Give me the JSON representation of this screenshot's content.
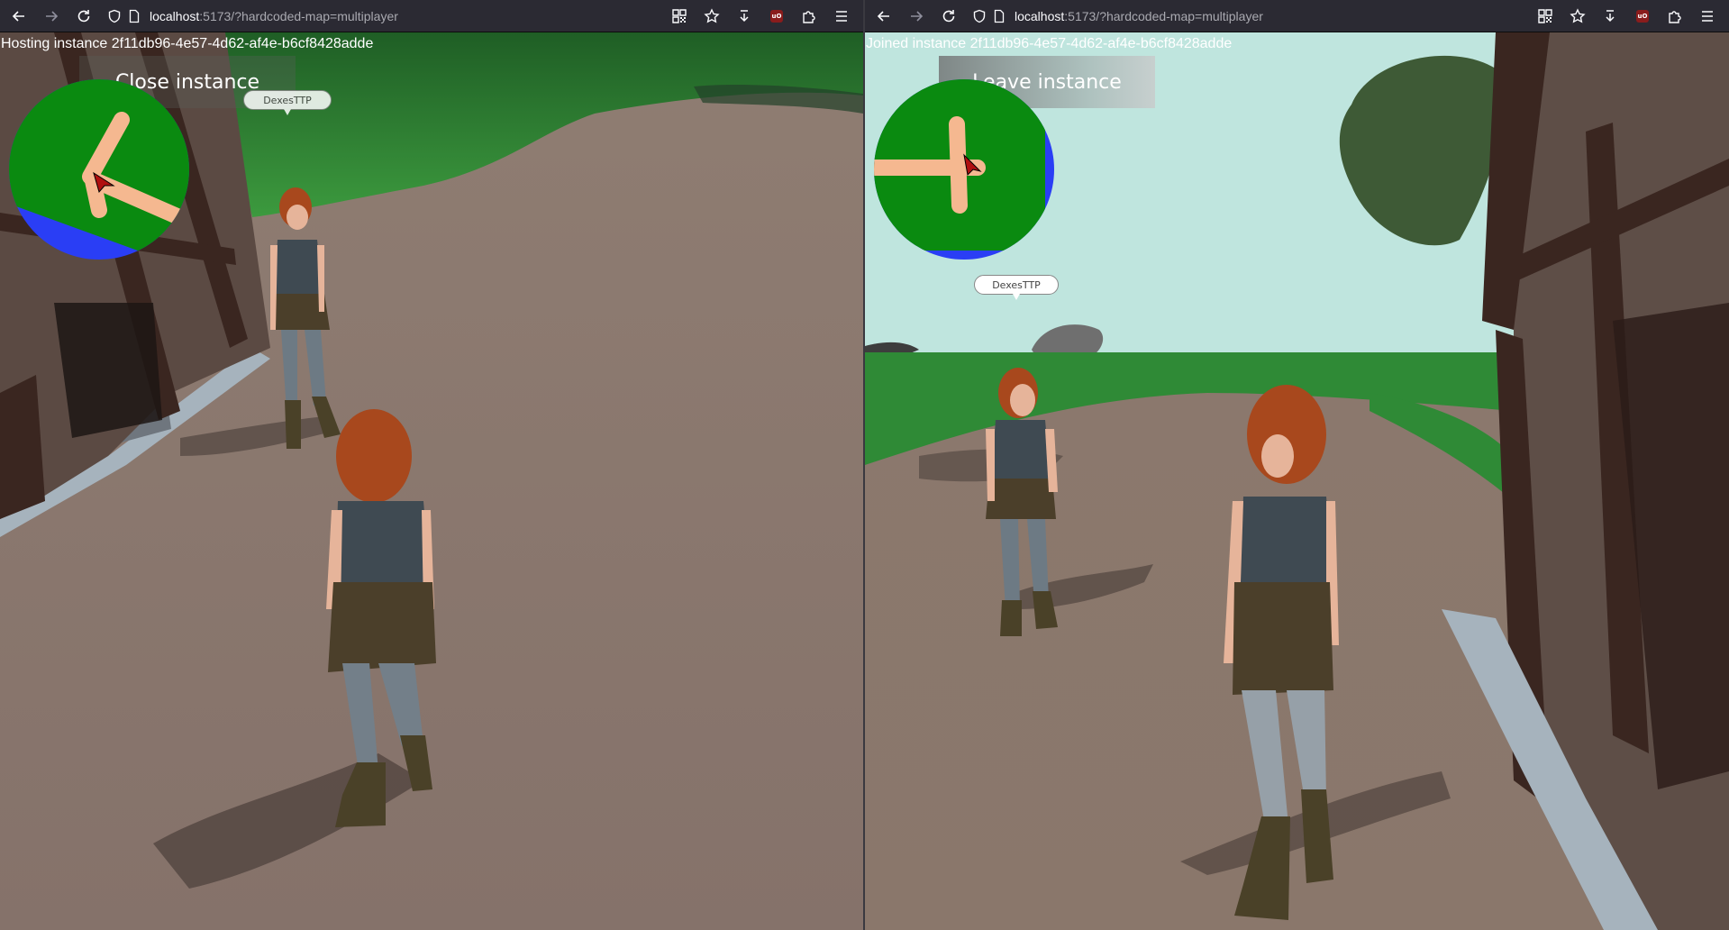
{
  "left_window": {
    "url_host": "localhost",
    "url_rest": ":5173/?hardcoded-map=multiplayer",
    "instance_status": "Hosting instance 2f11db96-4e57-4d62-af4e-b6cf8428adde",
    "instance_button": "Close instance",
    "nametag": "DexesTTP"
  },
  "right_window": {
    "url_host": "localhost",
    "url_rest": ":5173/?hardcoded-map=multiplayer",
    "instance_status": "Joined instance 2f11db96-4e57-4d62-af4e-b6cf8428adde",
    "instance_button": "Leave instance",
    "nametag": "DexesTTP"
  },
  "icons": {
    "back": "back-arrow-icon",
    "forward": "forward-arrow-icon",
    "reload": "reload-icon",
    "tracking_protection": "shield-icon",
    "page": "page-icon",
    "qr": "qr-code-icon",
    "bookmark": "star-icon",
    "pocket": "save-to-pocket-icon",
    "ublock": "ublock-origin-icon",
    "extensions": "puzzle-icon",
    "menu": "hamburger-menu-icon"
  },
  "colors": {
    "toolbar": "#2b2a33",
    "ground": "#8a776b",
    "grass": "#2f8a36",
    "sky": "#bfe5de",
    "minimap_green": "#0a8a10",
    "minimap_path": "#f5b890",
    "minimap_blue": "#2a3ef5"
  }
}
